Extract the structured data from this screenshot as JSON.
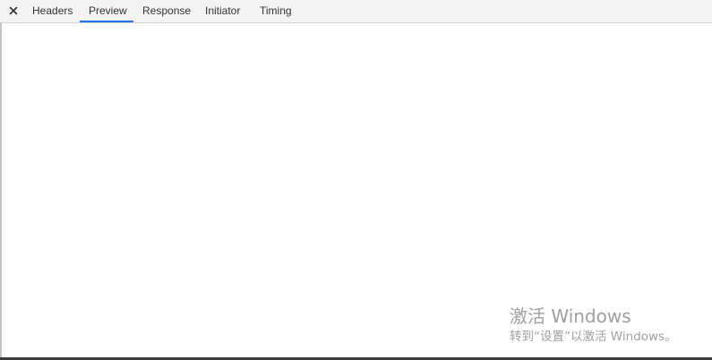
{
  "devtools": {
    "close_icon": "close-icon",
    "tabs": [
      {
        "label": "Headers",
        "selected": false
      },
      {
        "label": "Preview",
        "selected": true
      },
      {
        "label": "Response",
        "selected": false
      },
      {
        "label": "Initiator",
        "selected": false
      },
      {
        "label": "Timing",
        "selected": false
      }
    ],
    "accent_color": "#1a73e8"
  },
  "watermark": {
    "title": "激活 Windows",
    "subtitle": "转到“设置”以激活 Windows。"
  }
}
